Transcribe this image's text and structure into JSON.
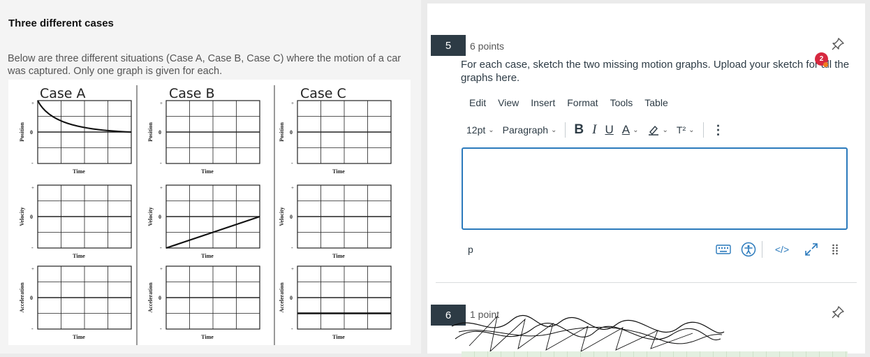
{
  "left": {
    "title": "Three different cases",
    "description": "Below are three different situations (Case A, Case B, Case C) where the motion of a car was captured. Only one graph is given for each.",
    "figure": {
      "cases": [
        "Case A",
        "Case B",
        "Case C"
      ],
      "row_labels": [
        "Position",
        "Velocity",
        "Acceleration"
      ],
      "x_label": "Time",
      "tick_plus": "+",
      "tick_zero": "0",
      "tick_minus": "-"
    }
  },
  "question5": {
    "number": "5",
    "points": "6 points",
    "text": "For each case, sketch the two missing motion graphs. Upload your sketch for all the graphs here.",
    "badge_count": "2",
    "editor": {
      "menu": [
        "Edit",
        "View",
        "Insert",
        "Format",
        "Tools",
        "Table"
      ],
      "font_size": "12pt",
      "block_format": "Paragraph",
      "bold": "B",
      "italic": "I",
      "underline": "U",
      "text_color": "A",
      "superscript": "T²",
      "more": "⋮",
      "path": "p",
      "html_toggle": "</>"
    }
  },
  "question6": {
    "number": "6",
    "points": "1 point"
  },
  "colors": {
    "accent": "#2b7abc",
    "qnum_bg": "#2d3b45",
    "badge": "#d7283f"
  }
}
